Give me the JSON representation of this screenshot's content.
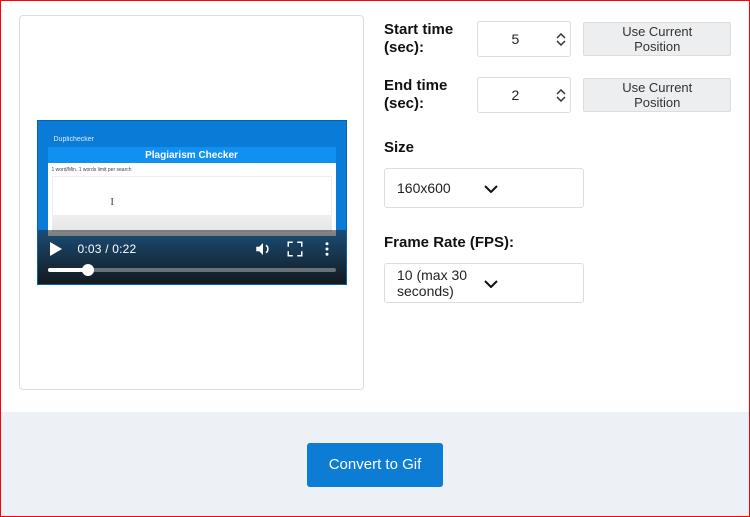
{
  "video": {
    "logo_text": "Duplichecker",
    "header_text": "Plagiarism Checker",
    "tiny_text": "1 word/Min. 1 words limit per search",
    "current_time": "0:03",
    "duration": "0:22"
  },
  "settings": {
    "start_time_label": "Start time (sec):",
    "start_time_value": "5",
    "end_time_label": "End time (sec):",
    "end_time_value": "2",
    "use_current_label": "Use Current Position",
    "size_label": "Size",
    "size_value": "160x600",
    "frame_rate_label": "Frame Rate (FPS):",
    "frame_rate_value": "10 (max 30 seconds)"
  },
  "actions": {
    "convert_label": "Convert to Gif"
  }
}
